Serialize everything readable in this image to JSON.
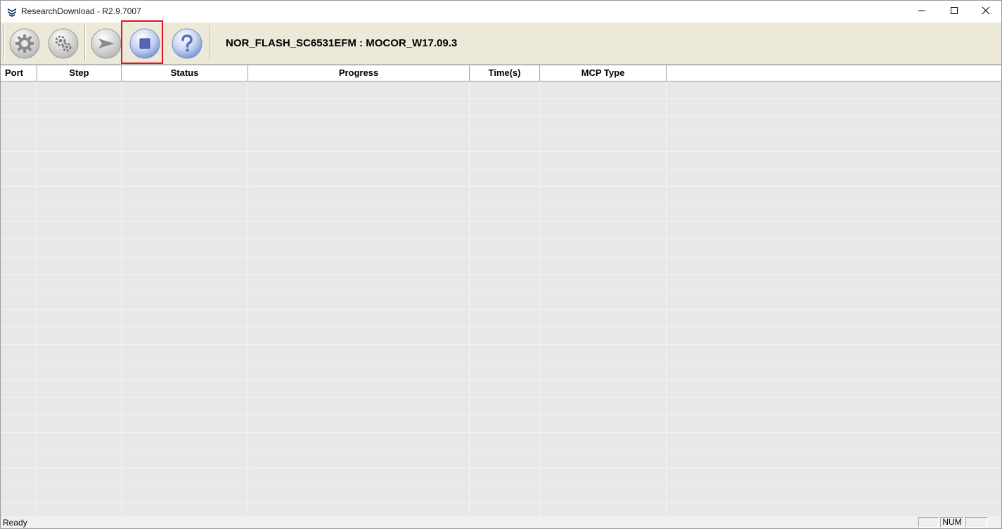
{
  "window": {
    "title": "ResearchDownload - R2.9.7007"
  },
  "toolbar": {
    "buttons": [
      {
        "name": "load-packet-icon",
        "tooltip": ""
      },
      {
        "name": "settings-gears-icon",
        "tooltip": ""
      },
      {
        "name": "start-download-icon",
        "tooltip": ""
      },
      {
        "name": "stop-download-icon",
        "tooltip": ""
      },
      {
        "name": "help-icon",
        "tooltip": ""
      }
    ],
    "project_label": "NOR_FLASH_SC6531EFM : MOCOR_W17.09.3"
  },
  "grid": {
    "columns": [
      "Port",
      "Step",
      "Status",
      "Progress",
      "Time(s)",
      "MCP Type",
      ""
    ],
    "rows": []
  },
  "statusbar": {
    "status": "Ready",
    "num": "NUM"
  },
  "colors": {
    "toolbar_bg": "#ece9d8",
    "highlight": "#e0141e",
    "grid_bg": "#e8e8e8"
  }
}
